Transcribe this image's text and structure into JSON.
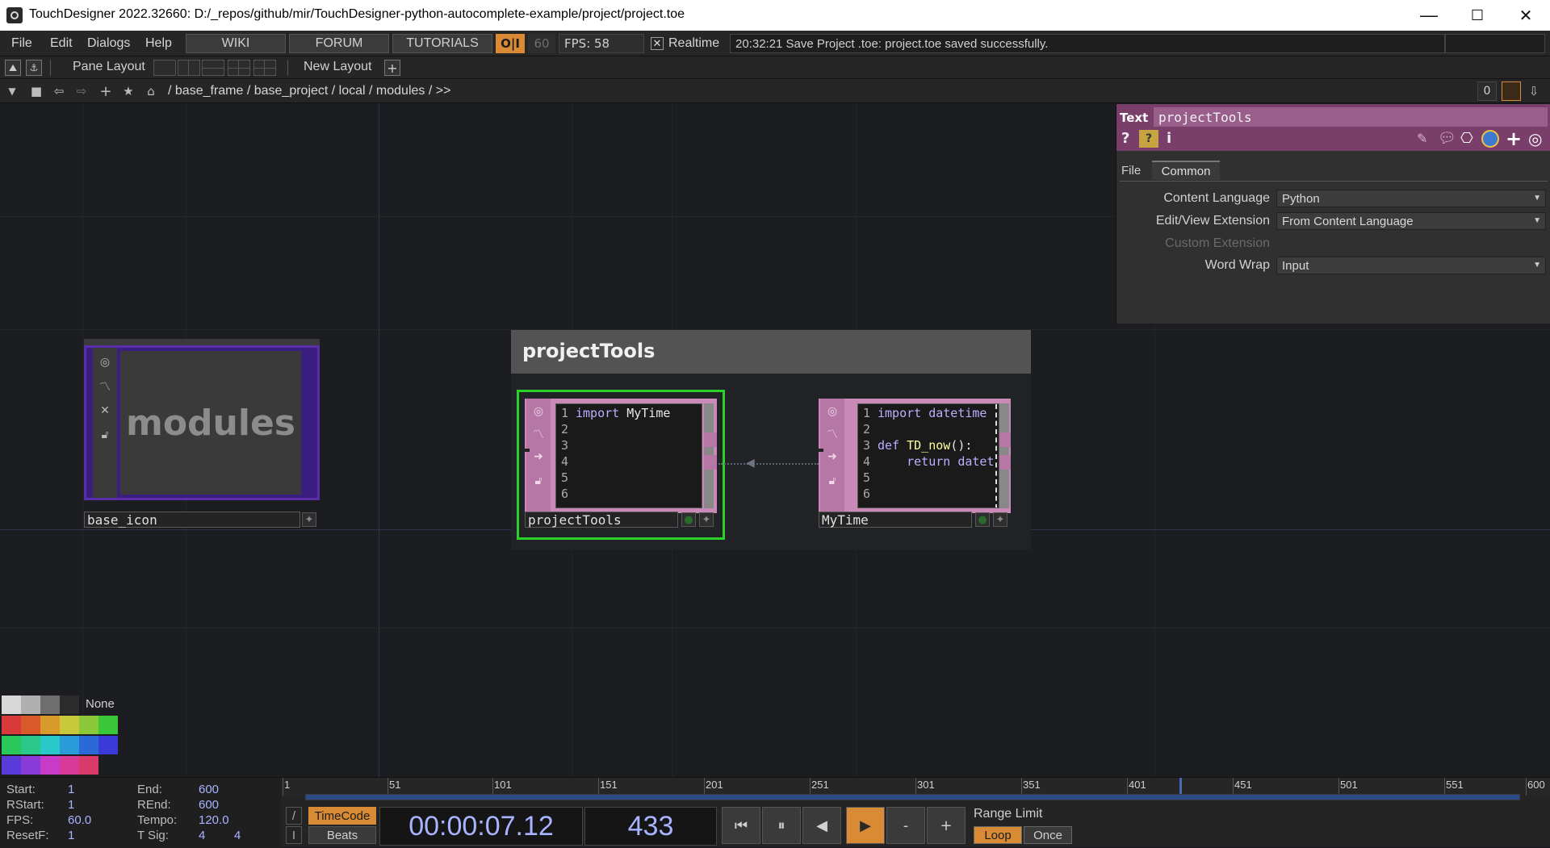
{
  "window": {
    "title": "TouchDesigner 2022.32660: D:/_repos/github/mir/TouchDesigner-python-autocomplete-example/project/project.toe",
    "minimize": "—",
    "maximize": "☐",
    "close": "✕"
  },
  "menubar": {
    "file": "File",
    "edit": "Edit",
    "dialogs": "Dialogs",
    "help": "Help",
    "wiki": "WIKI",
    "forum": "FORUM",
    "tutorials": "TUTORIALS",
    "oi": "O|I",
    "fps_cap": "60",
    "fps_label": "FPS:  58",
    "realtime_checked": "✕",
    "realtime_label": "Realtime",
    "status": "20:32:21 Save Project .toe: project.toe saved successfully."
  },
  "panebar": {
    "pane_layout": "Pane Layout",
    "new_layout": "New Layout",
    "add": "+"
  },
  "pathbar": {
    "path": "/ base_frame / base_project / local / modules / >>",
    "counter": "0"
  },
  "network": {
    "base_icon": {
      "display_text": "modules",
      "name": "base_icon"
    },
    "annotation": {
      "title": "projectTools"
    },
    "project_tools": {
      "name": "projectTools",
      "lines": [
        {
          "n": "1",
          "code": "import MyTime"
        },
        {
          "n": "2",
          "code": ""
        },
        {
          "n": "3",
          "code": ""
        },
        {
          "n": "4",
          "code": ""
        },
        {
          "n": "5",
          "code": ""
        },
        {
          "n": "6",
          "code": ""
        }
      ]
    },
    "my_time": {
      "name": "MyTime",
      "line1": "import datetime",
      "line3_def": "def",
      "line3_fn": "TD_now",
      "line3_rest": "():",
      "line4": "    return datet",
      "line_numbers": [
        "1",
        "2",
        "3",
        "4",
        "5",
        "6"
      ]
    }
  },
  "params": {
    "op_type": "Text",
    "op_name": "projectTools",
    "tabs": [
      "File",
      "Common"
    ],
    "rows": [
      {
        "label": "Content Language",
        "value": "Python"
      },
      {
        "label": "Edit/View Extension",
        "value": "From Content Language"
      },
      {
        "label": "Custom Extension",
        "value": ""
      },
      {
        "label": "Word Wrap",
        "value": "Input"
      }
    ]
  },
  "palette": {
    "none_label": "None",
    "colors": [
      [
        "#d8d8d8",
        "#b0b0b0",
        "#6e6e6e",
        "#2c2c2c"
      ],
      [
        "#d83a3a",
        "#d85a2a",
        "#d89a2a",
        "#c8c83a",
        "#8ac83a",
        "#3ac83a"
      ],
      [
        "#2ac85a",
        "#2ac88a",
        "#2ac8c8",
        "#2a9ad8",
        "#2a6ad8",
        "#3a3ad8"
      ],
      [
        "#5a3ad8",
        "#8a3ad8",
        "#c83ac8",
        "#d83a9a",
        "#d83a6a"
      ]
    ]
  },
  "timeline": {
    "start_label": "Start:",
    "start": "1",
    "end_label": "End:",
    "end": "600",
    "rstart_label": "RStart:",
    "rstart": "1",
    "rend_label": "REnd:",
    "rend": "600",
    "fps_label": "FPS:",
    "fps": "60.0",
    "tempo_label": "Tempo:",
    "tempo": "120.0",
    "resetf_label": "ResetF:",
    "resetf": "1",
    "tsig_label": "T Sig:",
    "tsig_a": "4",
    "tsig_b": "4",
    "ticks": [
      "1",
      "51",
      "101",
      "151",
      "201",
      "251",
      "301",
      "351",
      "401",
      "451",
      "501",
      "551",
      "600"
    ],
    "playhead_frame": 433,
    "timecode_label": "TimeCode",
    "beats_label": "Beats",
    "timecode": "00:00:07.12",
    "frame": "433",
    "minus": "-",
    "plus": "+",
    "range_limit": "Range Limit",
    "loop": "Loop",
    "once": "Once"
  }
}
